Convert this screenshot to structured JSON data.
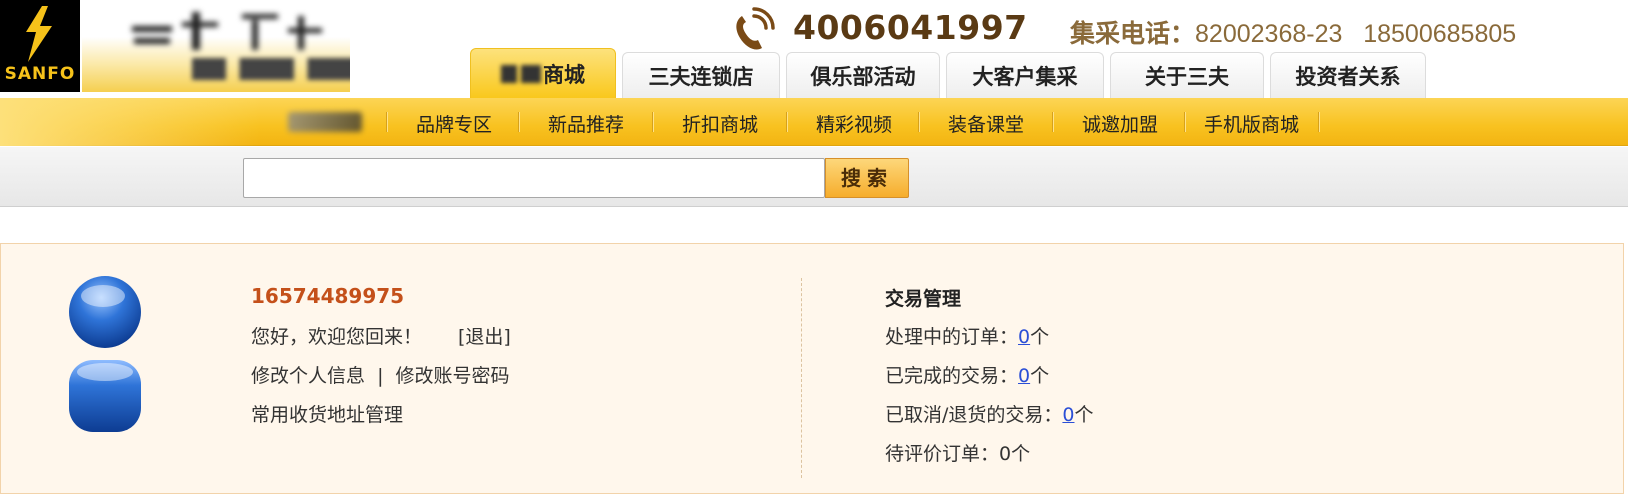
{
  "header": {
    "logo_text": "SANFO",
    "hotline": "4006041997",
    "group_buy_label": "集采电话：",
    "group_buy_numbers": "82002368-23   18500685805"
  },
  "main_tabs": [
    {
      "label": "商城",
      "active": true
    },
    {
      "label": "三夫连锁店",
      "active": false
    },
    {
      "label": "俱乐部活动",
      "active": false
    },
    {
      "label": "大客户集采",
      "active": false
    },
    {
      "label": "关于三夫",
      "active": false
    },
    {
      "label": "投资者关系",
      "active": false
    }
  ],
  "sub_nav": [
    {
      "label": "品牌专区"
    },
    {
      "label": "新品推荐"
    },
    {
      "label": "折扣商城"
    },
    {
      "label": "精彩视频"
    },
    {
      "label": "装备课堂"
    },
    {
      "label": "诚邀加盟"
    },
    {
      "label": "手机版商城"
    }
  ],
  "search": {
    "value": "",
    "placeholder": "",
    "button_label": "搜索"
  },
  "user": {
    "phone": "16574489975",
    "greeting": "您好，欢迎您回来！",
    "logout_label": "[退出]",
    "edit_profile": "修改个人信息",
    "separator": "|",
    "change_password": "修改账号密码",
    "address_manage": "常用收货地址管理"
  },
  "trade": {
    "title": "交易管理",
    "processing_label": "处理中的订单：",
    "processing_count": "0",
    "completed_label": "已完成的交易：",
    "completed_count": "0",
    "cancelled_label": "已取消/退货的交易：",
    "cancelled_count": "0",
    "pending_review_label": "待评价订单：",
    "pending_review_count": "0",
    "unit": "个"
  },
  "colors": {
    "accent_yellow": "#f8c220",
    "username_orange": "#c4501a",
    "link_blue": "#2b4fd6",
    "panel_bg": "#fff7ec"
  }
}
